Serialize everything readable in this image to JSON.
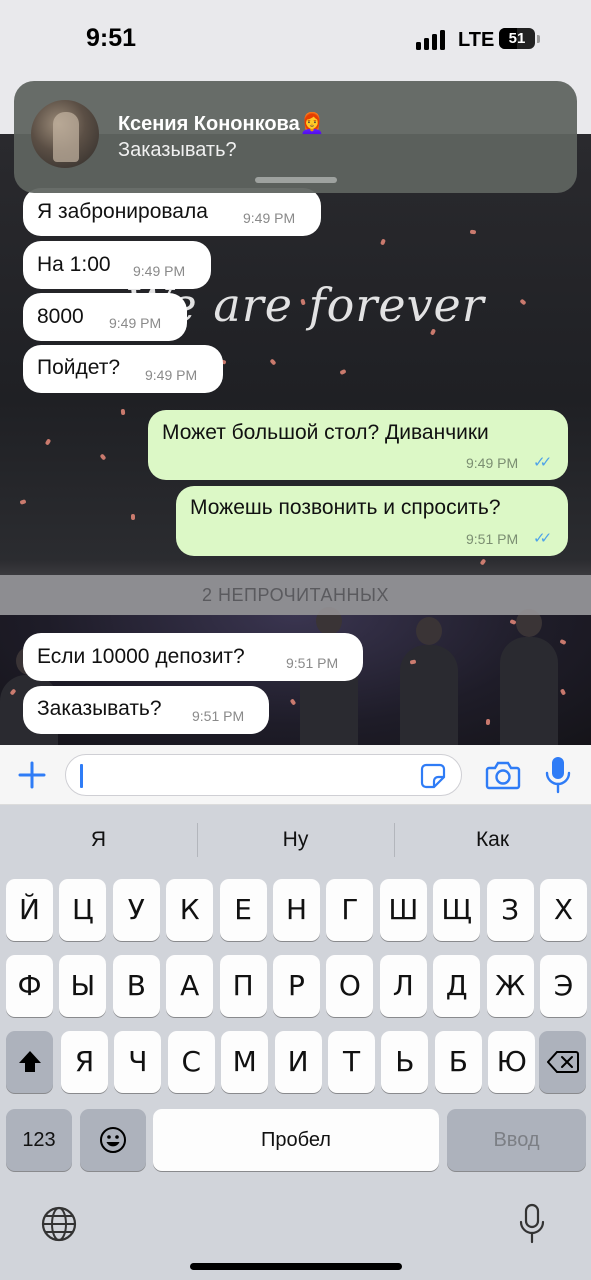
{
  "status_bar": {
    "time": "9:51",
    "network": "LTE",
    "battery": "51",
    "battery_level": 0.51
  },
  "notification": {
    "sender": "Ксения Кононкова👩‍🦰",
    "message": "Заказывать?"
  },
  "chat": {
    "background_text": "We are forever",
    "messages": [
      {
        "direction": "in",
        "text": "Я забронировала",
        "time": "9:49 PM"
      },
      {
        "direction": "in",
        "text": "На 1:00",
        "time": "9:49 PM"
      },
      {
        "direction": "in",
        "text": "8000",
        "time": "9:49 PM"
      },
      {
        "direction": "in",
        "text": "Пойдет?",
        "time": "9:49 PM"
      },
      {
        "direction": "out",
        "text": "Может большой стол? Диванчики",
        "time": "9:49 PM",
        "status": "read"
      },
      {
        "direction": "out",
        "text": "Можешь позвонить и спросить?",
        "time": "9:51 PM",
        "status": "read"
      },
      {
        "direction": "in",
        "text": "Если 10000 депозит?",
        "time": "9:51 PM"
      },
      {
        "direction": "in",
        "text": "Заказывать?",
        "time": "9:51 PM"
      }
    ],
    "unread_divider": "2 НЕПРОЧИТАННЫХ"
  },
  "input_bar": {
    "placeholder": "",
    "icons": [
      "plus-icon",
      "sticker-icon",
      "camera-icon",
      "microphone-icon"
    ]
  },
  "keyboard": {
    "suggestions": [
      "Я",
      "Ну",
      "Как"
    ],
    "rows": [
      [
        "Й",
        "Ц",
        "У",
        "К",
        "Е",
        "Н",
        "Г",
        "Ш",
        "Щ",
        "З",
        "Х"
      ],
      [
        "Ф",
        "Ы",
        "В",
        "А",
        "П",
        "Р",
        "О",
        "Л",
        "Д",
        "Ж",
        "Э"
      ],
      [
        "Я",
        "Ч",
        "С",
        "М",
        "И",
        "Т",
        "Ь",
        "Б",
        "Ю"
      ]
    ],
    "numbers_key": "123",
    "space_key": "Пробел",
    "return_key": "Ввод",
    "icons": [
      "shift-icon",
      "backspace-icon",
      "emoji-icon",
      "globe-icon",
      "dictation-icon"
    ]
  },
  "colors": {
    "incoming_bubble": "#ffffff",
    "outgoing_bubble": "#dcf8c6",
    "read_ticks": "#4fa3e8",
    "keyboard_bg": "#d1d4da"
  }
}
